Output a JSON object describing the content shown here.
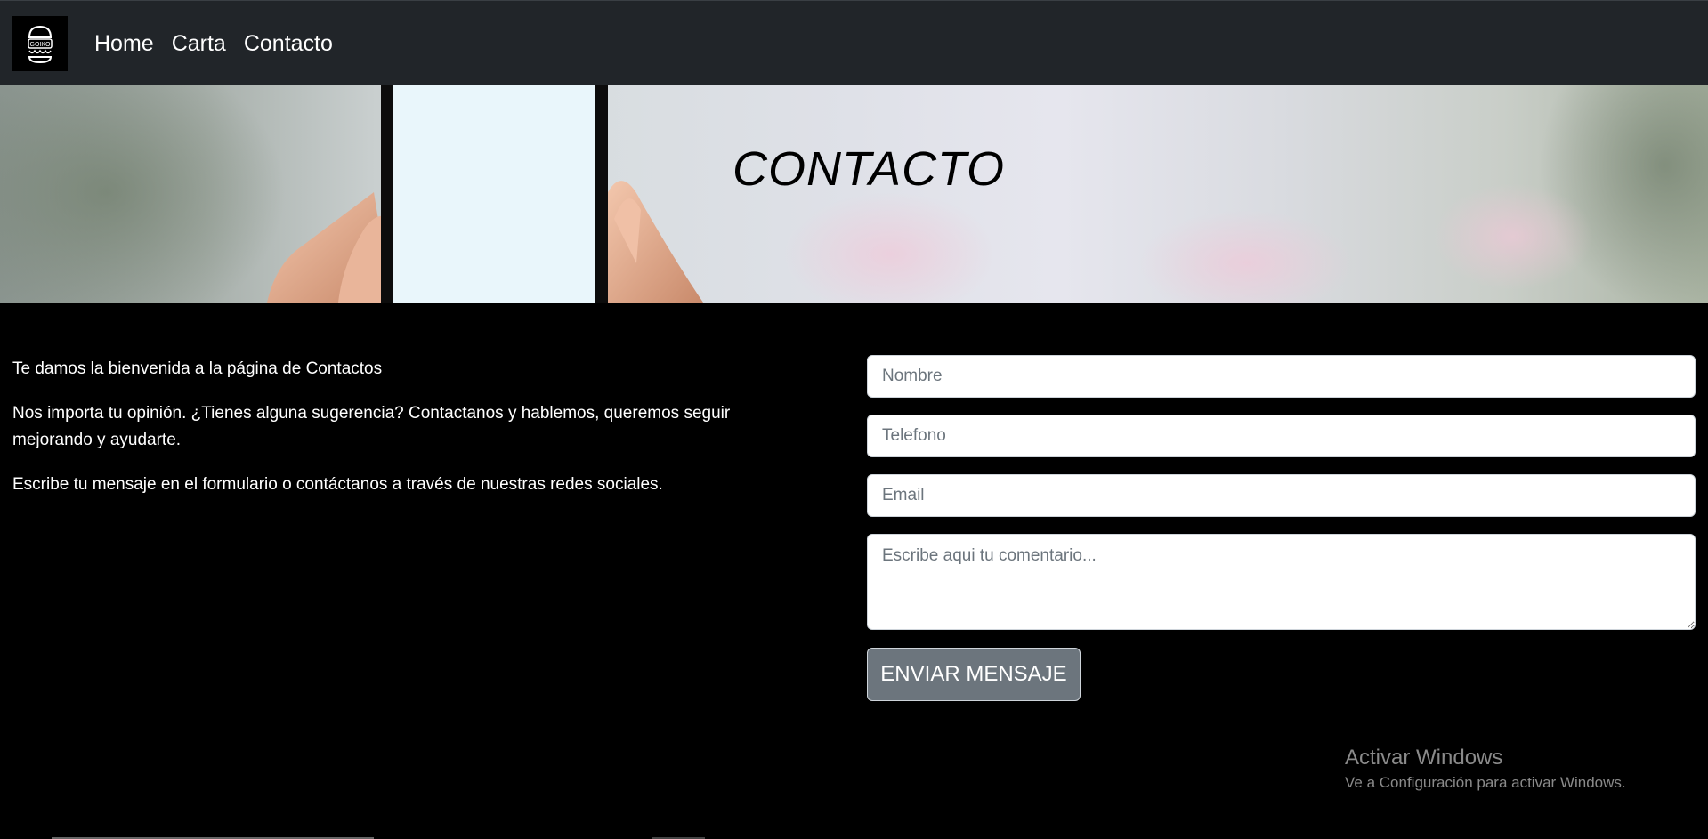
{
  "navbar": {
    "logo_text": "GOIKO",
    "links": [
      "Home",
      "Carta",
      "Contacto"
    ]
  },
  "hero": {
    "title": "CONTACTO"
  },
  "intro": {
    "paragraphs": [
      "Te damos la bienvenida a la página de Contactos",
      "Nos importa tu opinión. ¿Tienes alguna sugerencia? Contactanos y hablemos, queremos seguir mejorando y ayudarte.",
      "Escribe tu mensaje en el formulario o contáctanos a través de nuestras redes sociales."
    ]
  },
  "form": {
    "name_placeholder": "Nombre",
    "phone_placeholder": "Telefono",
    "email_placeholder": "Email",
    "comment_placeholder": "Escribe aqui tu comentario...",
    "submit_label": "ENVIAR MENSAJE"
  },
  "watermark": {
    "title": "Activar Windows",
    "subtitle": "Ve a Configuración para activar Windows."
  }
}
